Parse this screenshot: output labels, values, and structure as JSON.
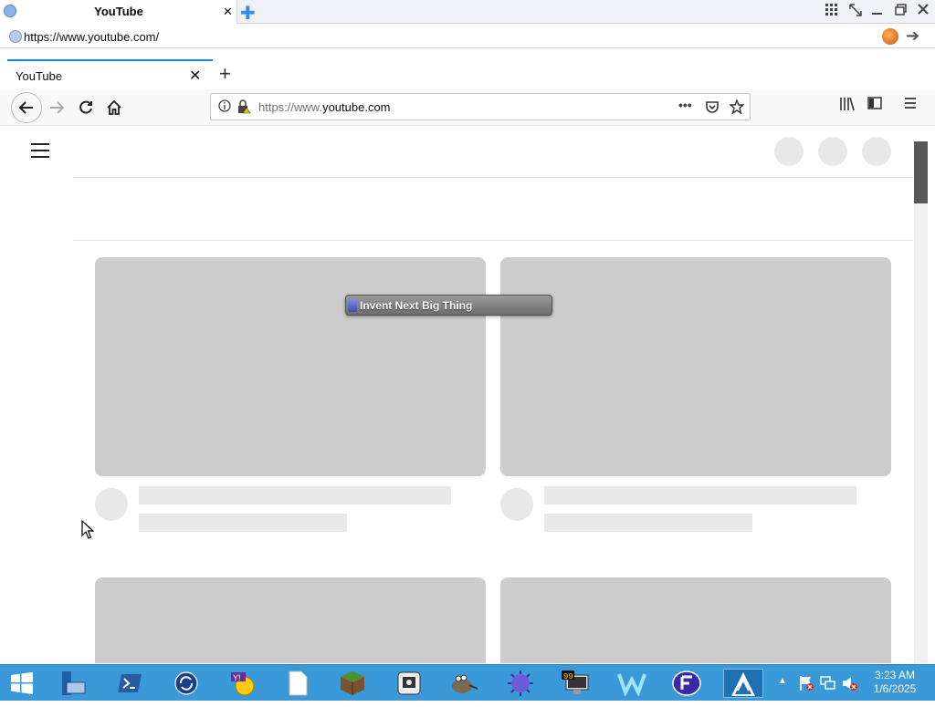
{
  "outer": {
    "tab_title": "YouTube",
    "tab_close": "✕",
    "new_tab": "✚",
    "url": "https://www.youtube.com/",
    "go": "➔"
  },
  "firefox": {
    "tab_title": "YouTube",
    "tab_close": "✕",
    "new_tab": "+",
    "url_prefix": "https://www.",
    "url_domain": "youtube.com"
  },
  "overlay": {
    "label": "Invent Next Big Thing"
  },
  "clock": {
    "time": "3:23 AM",
    "date": "1/6/2025"
  },
  "icons": {
    "back": "back-arrow-icon",
    "forward": "forward-arrow-icon",
    "reload": "reload-icon",
    "home": "home-icon",
    "library": "library-icon",
    "sidebar": "sidebar-icon",
    "menu": "menu-icon"
  }
}
